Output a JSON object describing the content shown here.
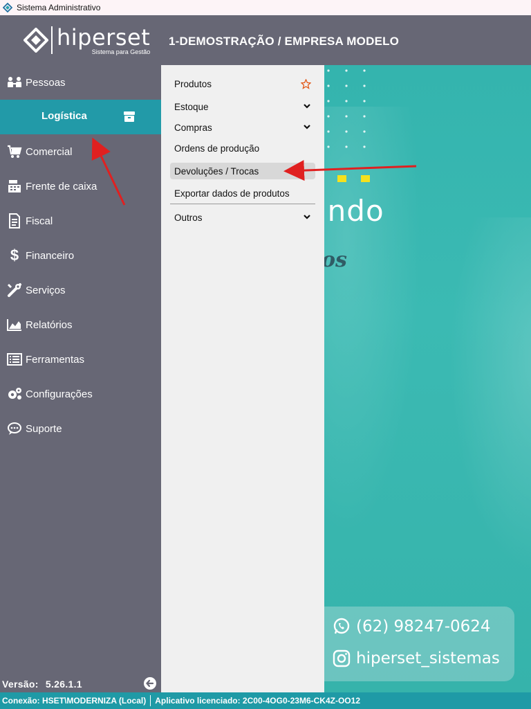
{
  "window": {
    "title": "Sistema Administrativo"
  },
  "logo": {
    "name": "hiperset",
    "tagline": "Sistema para Gestão"
  },
  "header": {
    "company": "1-DEMOSTRAÇÃO / EMPRESA MODELO"
  },
  "sidebar": {
    "items": [
      {
        "label": "Pessoas",
        "icon": "people-icon"
      },
      {
        "label": "Logística",
        "icon": "box-icon",
        "active": true
      },
      {
        "label": "Comercial",
        "icon": "cart-icon"
      },
      {
        "label": "Frente de caixa",
        "icon": "cash-register-icon"
      },
      {
        "label": "Fiscal",
        "icon": "document-icon"
      },
      {
        "label": "Financeiro",
        "icon": "dollar-icon"
      },
      {
        "label": "Serviços",
        "icon": "tools-icon"
      },
      {
        "label": "Relatórios",
        "icon": "chart-icon"
      },
      {
        "label": "Ferramentas",
        "icon": "list-icon"
      },
      {
        "label": "Configurações",
        "icon": "gears-icon"
      },
      {
        "label": "Suporte",
        "icon": "chat-icon"
      }
    ],
    "version_label": "Versão:",
    "version_value": "5.26.1.1"
  },
  "submenu": {
    "items": [
      {
        "label": "Produtos",
        "trailing": "star-icon"
      },
      {
        "label": "Estoque",
        "trailing": "chevron-down-icon"
      },
      {
        "label": "Compras",
        "trailing": "chevron-down-icon"
      },
      {
        "label": "Ordens de produção"
      },
      {
        "label": "Devoluções / Trocas",
        "highlighted": true
      },
      {
        "label": "Exportar dados de produtos"
      },
      {
        "label": "Outros",
        "trailing": "chevron-down-icon"
      }
    ]
  },
  "banner": {
    "word": "indo",
    "script": "os",
    "phone": "(62) 98247-0624",
    "instagram": "hiperset_sistemas"
  },
  "statusbar": {
    "connection": "Conexão: HSET\\MODERNIZA (Local)",
    "license": "Aplicativo licenciado: 2C00-4OG0-23M6-CK4Z-OO12"
  },
  "colors": {
    "sidebar_bg": "#676775",
    "active_bg": "#229aa8",
    "statusbar_bg": "#1f9aa6",
    "banner_bg": "#3bbab3",
    "arrow_red": "#e02020",
    "star_orange": "#e2591a"
  }
}
